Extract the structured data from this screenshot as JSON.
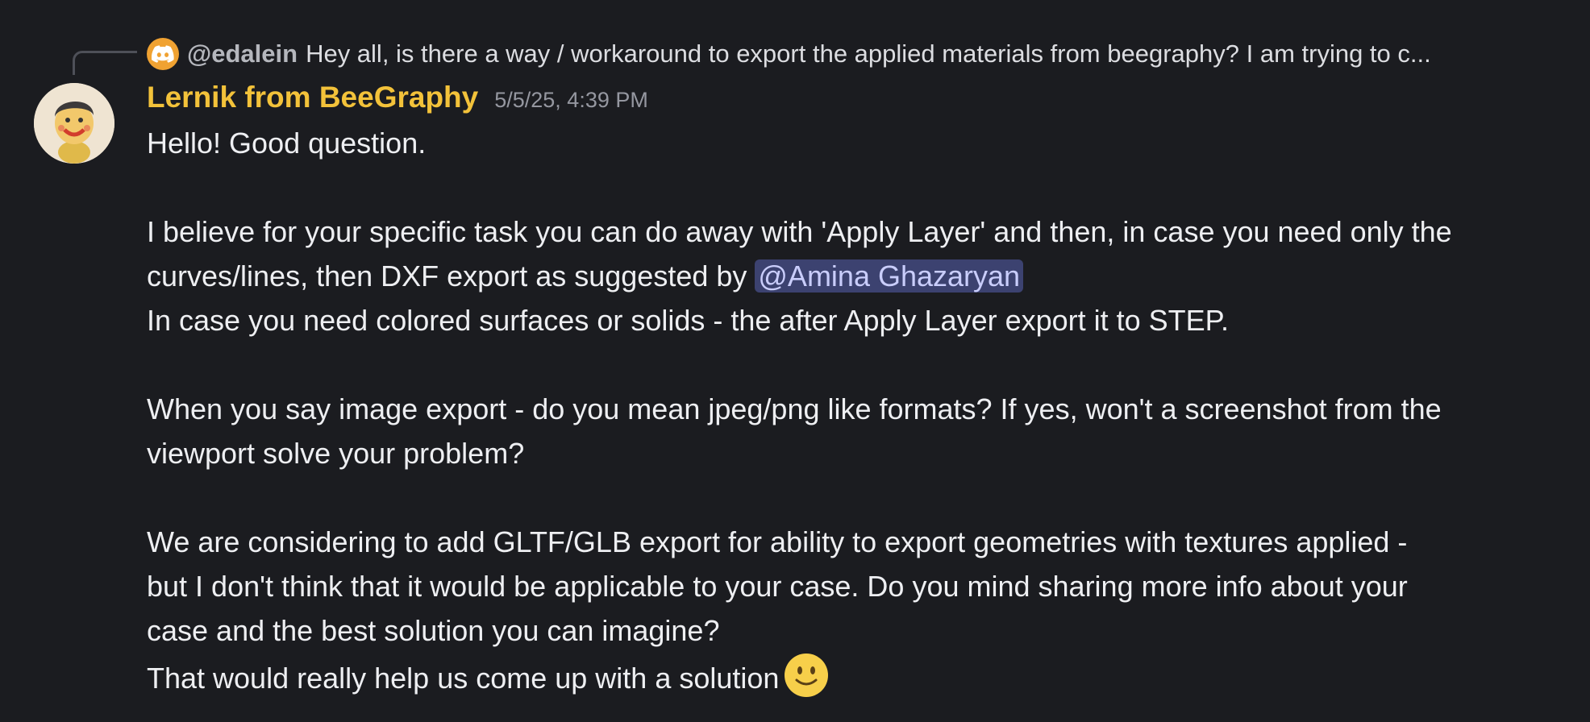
{
  "reply": {
    "author": "@edalein",
    "preview": "Hey all, is there a way / workaround to export the applied materials from beegraphy? I am trying to c..."
  },
  "message": {
    "author": "Lernik from BeeGraphy",
    "timestamp": "5/5/25, 4:39 PM",
    "lines": {
      "l1": "Hello! Good question.",
      "l2": "I believe for your specific task you can do away with 'Apply Layer' and then, in case you need only the",
      "l3_pre": "curves/lines, then DXF export as suggested by ",
      "l3_mention": "@Amina Ghazaryan",
      "l4": "In case you need colored surfaces or solids - the after Apply Layer export it to STEP.",
      "l5": "When you say image export - do you mean jpeg/png like formats? If yes, won't a screenshot from the",
      "l6": "viewport solve your problem?",
      "l7": "We are considering to add GLTF/GLB export for ability to export geometries with textures applied -",
      "l8": "but I don't think that it would be applicable to your case. Do you mind sharing more info about your",
      "l9": "case and the best solution you can imagine?",
      "l10": "That would really help us come up with a solution"
    }
  },
  "colors": {
    "background": "#1b1c20",
    "author": "#f3c23a",
    "mention_bg": "#3c4270",
    "mention_text": "#c9cdfb"
  },
  "icons": {
    "reply_avatar": "discord-logo-icon",
    "emoji": "slightly-smiling-face-icon"
  }
}
